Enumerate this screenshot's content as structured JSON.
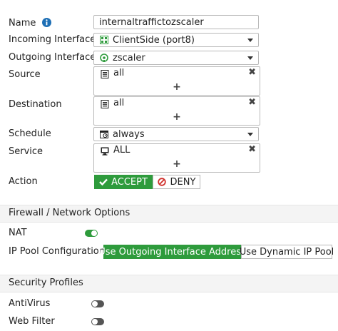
{
  "form": {
    "name_label": "Name",
    "name_value": "internaltraffictozscaler",
    "incoming_label": "Incoming Interface",
    "incoming_value": "ClientSide (port8)",
    "outgoing_label": "Outgoing Interface",
    "outgoing_value": "zscaler",
    "source_label": "Source",
    "source_value": "all",
    "destination_label": "Destination",
    "destination_value": "all",
    "schedule_label": "Schedule",
    "schedule_value": "always",
    "service_label": "Service",
    "service_value": "ALL",
    "action_label": "Action",
    "accept_label": "ACCEPT",
    "deny_label": "DENY",
    "remove_glyph": "✖",
    "add_glyph": "+"
  },
  "firewall_section": {
    "title": "Firewall / Network Options",
    "nat_label": "NAT",
    "nat_enabled": true,
    "ip_pool_label": "IP Pool Configuration",
    "ip_pool_option1": "Use Outgoing Interface Address",
    "ip_pool_option2": "Use Dynamic IP Pool",
    "ip_pool_selected": "Use Outgoing Interface Address"
  },
  "security_section": {
    "title": "Security Profiles",
    "antivirus_label": "AntiVirus",
    "antivirus_enabled": false,
    "webfilter_label": "Web Filter",
    "webfilter_enabled": false
  },
  "colors": {
    "accent_green": "#2e9b3c",
    "info_blue": "#1e6fb5",
    "deny_red": "#d0312d"
  }
}
